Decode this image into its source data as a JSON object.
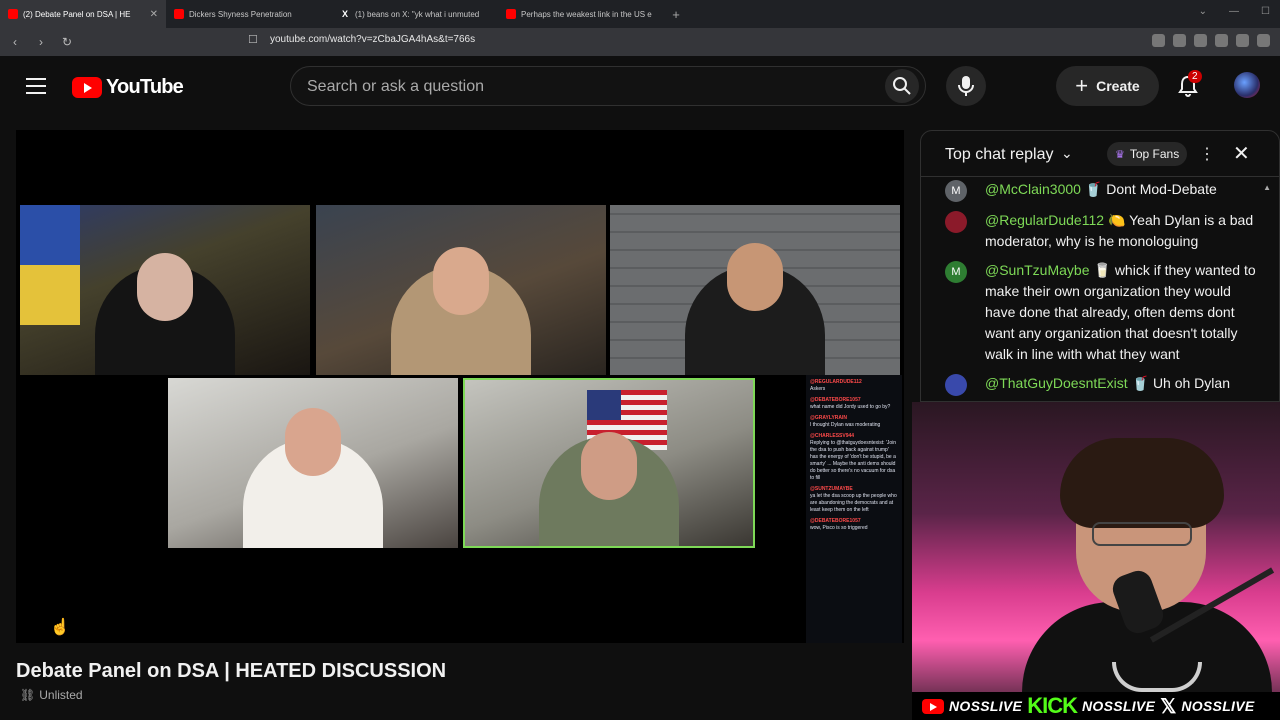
{
  "browser": {
    "tabs": [
      {
        "title": "(2) Debate Panel on DSA | HE",
        "favicon": "youtube-icon",
        "active": true
      },
      {
        "title": "Dickers Shyness Penetration",
        "favicon": "youtube-icon",
        "active": false
      },
      {
        "title": "(1) beans on X: \"yk what i unmuted",
        "favicon": "x-icon",
        "active": false
      },
      {
        "title": "Perhaps the weakest link in the US e",
        "favicon": "youtube-icon",
        "active": false
      }
    ],
    "url": "youtube.com/watch?v=zCbaJGA4hAs&t=766s"
  },
  "header": {
    "logo_text": "YouTube",
    "search_placeholder": "Search or ask a question",
    "create_label": "Create",
    "notification_count": "2"
  },
  "video": {
    "title": "Debate Panel on DSA | HEATED DISCUSSION",
    "visibility": "Unlisted",
    "overlay_chat": [
      {
        "user": "@REGULARDUDE112",
        "text": "Askers"
      },
      {
        "user": "@DEBATEBORE1057",
        "text": "what name did Jordy used to go by?"
      },
      {
        "user": "@GRAYLYRAIN",
        "text": "I thought Dylan was moderating"
      },
      {
        "user": "@CHARLESSV944",
        "text": "Replying to @thatguydoesntexist: 'Join the dsa to push back against trump' has the energy of 'don't be stupid, be a smarty' ... Maybe the anti dems should do better so there's no vacuum for dsa to fill"
      },
      {
        "user": "@SUNTZUMAYBE",
        "text": "ya let the dsa scoop up the people who are abandoning the democrats and at least keep them on the left"
      },
      {
        "user": "@DEBATEBORE1057",
        "text": "wow, Pisco is so triggered"
      }
    ]
  },
  "chat": {
    "title": "Top chat replay",
    "top_fans_label": "Top Fans",
    "messages": [
      {
        "avatar": "M",
        "avatar_color": "#5f6368",
        "user": "@McClain3000",
        "emoji": "🥤",
        "text": "Dont Mod-Debate"
      },
      {
        "avatar": "",
        "avatar_color": "#8b1a2a",
        "user": "@RegularDude112",
        "emoji": "🍋",
        "text": "Yeah Dylan is a bad moderator, why is he monologuing"
      },
      {
        "avatar": "M",
        "avatar_color": "#2e7d32",
        "user": "@SunTzuMaybe",
        "emoji": "🥛",
        "text": "whick if they wanted to make their own organization they would have done that already, often dems dont want any organization that doesn't totally walk in line with what they want"
      },
      {
        "avatar": "",
        "avatar_color": "#3949ab",
        "user": "@ThatGuyDoesntExist",
        "emoji": "🥤",
        "text": "Uh oh Dylan"
      }
    ]
  },
  "socials": {
    "youtube_name": "NOSSLIVE",
    "kick_logo": "KICK",
    "kick_name": "NOSSLIVE",
    "x_name": "NOSSLIVE"
  },
  "colors": {
    "accent_red": "#ff0000",
    "chat_username": "#7ed957",
    "kick_green": "#53fc18"
  }
}
